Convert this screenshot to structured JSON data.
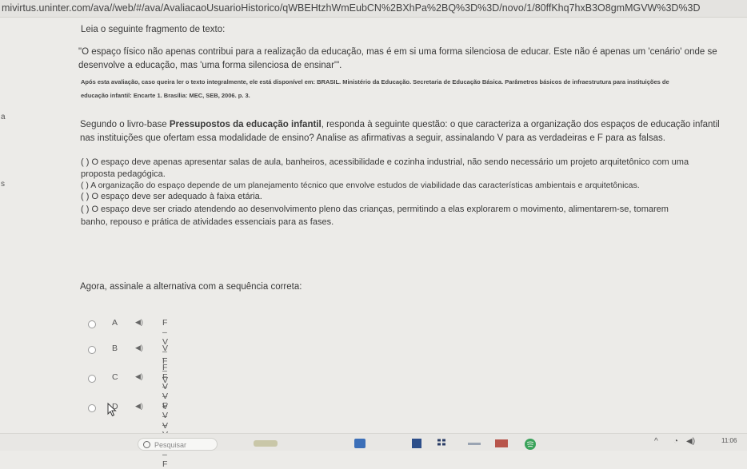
{
  "browser": {
    "url": "mivirtus.uninter.com/ava//web/#/ava/AvaliacaoUsuarioHistorico/qWBEHtzhWmEubCN%2BXhPa%2BQ%3D%3D/novo/1/80ffKhq7hxB3O8gmMGVW%3D%3D"
  },
  "question": {
    "instruction": "Leia o seguinte fragmento de texto:",
    "quote_line1": "\"O espaço físico não apenas contribui para a realização da educação, mas é em si uma forma silenciosa de educar. Este não é apenas um 'cenário' onde se",
    "quote_line2": "desenvolve a educação, mas 'uma forma silenciosa de ensinar'\".",
    "source_line1": "Após esta avaliação, caso queira ler o texto integralmente, ele está disponível em: BRASIL. Ministério da Educação. Secretaria de Educação Básica. Parâmetros básicos de infraestrutura para instituições de",
    "source_line2": "educação infantil: Encarte 1. Brasília: MEC, SEB, 2006. p. 3.",
    "stray_a": "a",
    "stray_s": "s",
    "context_prefix": "Segundo o livro-base ",
    "context_book": "Pressupostos da educação infantil",
    "context_line1_rest": ", responda à seguinte questão: o que caracteriza a organização dos espaços de educação infantil",
    "context_line2": "nas instituições que ofertam essa modalidade de ensino? Analise as afirmativas a seguir, assinalando V para as verdadeiras e F para as falsas.",
    "statements": [
      "( ) O espaço deve apenas apresentar salas de aula, banheiros, acessibilidade e cozinha industrial, não sendo necessário um projeto arquitetônico com uma",
      "proposta pedagógica.",
      "(  ) A organização do espaço depende de um planejamento técnico que envolve estudos de viabilidade das características ambientais e arquitetônicas.",
      "(  ) O espaço deve ser adequado à faixa etária.",
      "(  ) O espaço deve ser criado atendendo ao desenvolvimento pleno das crianças, permitindo a elas explorarem o movimento, alimentarem-se, tomarem",
      "banho, repouso e prática de atividades essenciais para as fases."
    ],
    "prompt": "Agora, assinale a alternativa com a sequência correta:",
    "options": [
      {
        "letter": "A",
        "sequence": "F – V – F – V"
      },
      {
        "letter": "B",
        "sequence": "V – F – V – F"
      },
      {
        "letter": "C",
        "sequence": "F – V – V – V"
      },
      {
        "letter": "D",
        "sequence": "V – V – F – F"
      }
    ],
    "audio_icon": "speaker-icon"
  },
  "taskbar": {
    "search_placeholder": "Pesquisar",
    "tray_time": "11:06"
  },
  "colors": {
    "page_bg": "#ecebe8",
    "text": "#3a3a3a",
    "taskbar_bg": "#e8e7e4"
  }
}
